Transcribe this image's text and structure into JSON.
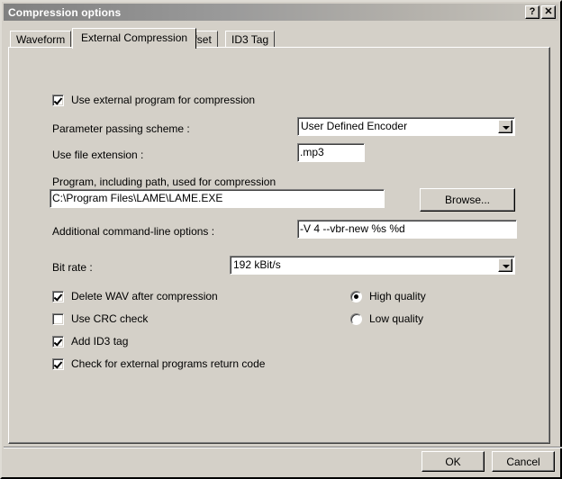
{
  "window": {
    "title": "Compression options",
    "help_button": "?",
    "close_button": "✕"
  },
  "tabs": [
    {
      "label": "Waveform",
      "active": false
    },
    {
      "label": "External Compression",
      "active": true
    },
    {
      "label": "Offset",
      "active": false
    },
    {
      "label": "ID3 Tag",
      "active": false
    }
  ],
  "form": {
    "use_external_label": "Use external program for compression",
    "use_external_checked": true,
    "param_scheme_label": "Parameter passing scheme :",
    "param_scheme_value": "User Defined Encoder",
    "file_extension_label": "Use file extension :",
    "file_extension_value": ".mp3",
    "program_path_label": "Program, including path, used for compression",
    "program_path_value": "C:\\Program Files\\LAME\\LAME.EXE",
    "browse_label": "Browse...",
    "cmdline_label": "Additional command-line options :",
    "cmdline_value": "-V 4 --vbr-new %s %d",
    "bitrate_label": "Bit rate :",
    "bitrate_value": "192 kBit/s",
    "checkboxes": [
      {
        "label": "Delete WAV after compression",
        "checked": true
      },
      {
        "label": "Use CRC check",
        "checked": false
      },
      {
        "label": "Add ID3 tag",
        "checked": true
      },
      {
        "label": "Check for external programs return code",
        "checked": true
      }
    ],
    "quality": {
      "options": [
        {
          "label": "High quality",
          "selected": true
        },
        {
          "label": "Low quality",
          "selected": false
        }
      ]
    }
  },
  "footer": {
    "ok_label": "OK",
    "cancel_label": "Cancel"
  },
  "colors": {
    "face": "#d4d0c8",
    "title_start": "#808080",
    "title_end": "#c6c3bc",
    "field_bg": "#ffffff",
    "text": "#000000"
  }
}
